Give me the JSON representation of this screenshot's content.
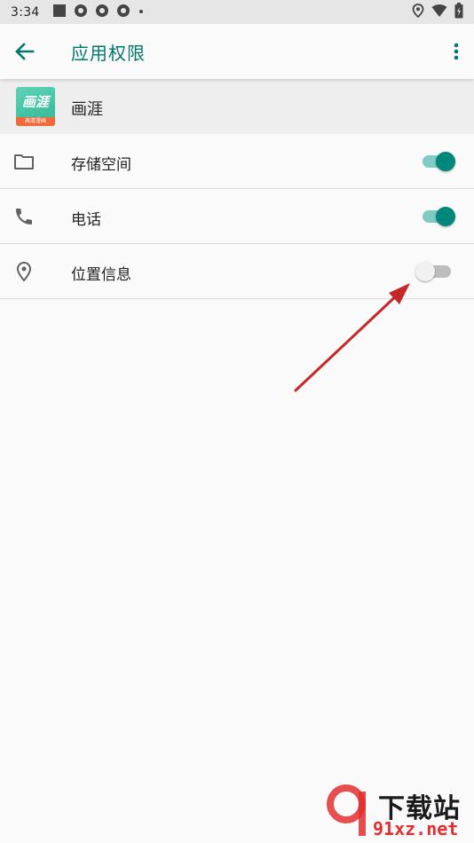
{
  "status_bar": {
    "time": "3:34",
    "icons": [
      "stop-square-icon",
      "aperture-icon",
      "aperture-icon",
      "aperture-icon",
      "dot-icon"
    ],
    "right_icons": [
      "location-pin-icon",
      "wifi-icon",
      "battery-icon"
    ]
  },
  "app_bar": {
    "title": "应用权限",
    "back_icon": "arrow-left-icon",
    "more_icon": "more-vert-icon",
    "accent": "#00796b"
  },
  "app": {
    "name": "画涯",
    "logo_text": "画涯",
    "logo_band_text": "高清漫画"
  },
  "permissions": [
    {
      "icon": "folder-icon",
      "label": "存储空间",
      "enabled": true
    },
    {
      "icon": "phone-icon",
      "label": "电话",
      "enabled": true
    },
    {
      "icon": "location-pin-icon",
      "label": "位置信息",
      "enabled": false
    }
  ],
  "watermark": {
    "text": "下载站",
    "url": "91xz.net"
  }
}
